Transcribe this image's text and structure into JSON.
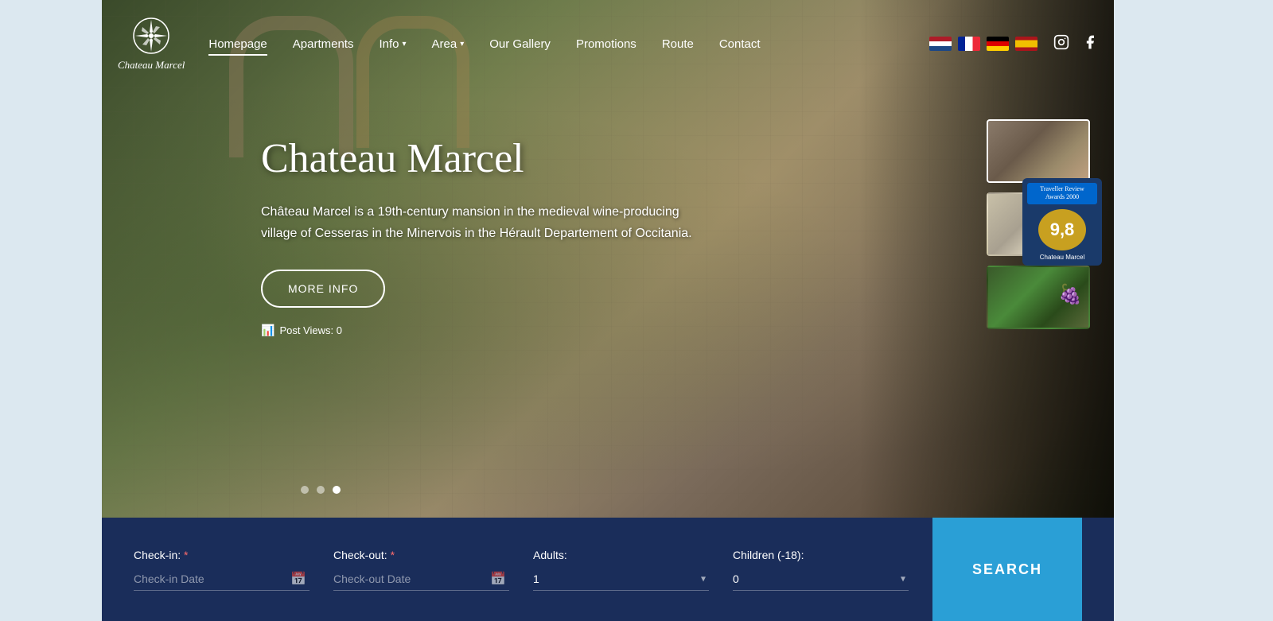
{
  "logo": {
    "line1": "Chateau Marcel"
  },
  "nav": {
    "links": [
      {
        "label": "Homepage",
        "active": true
      },
      {
        "label": "Apartments",
        "active": false
      },
      {
        "label": "Info",
        "active": false,
        "dropdown": true
      },
      {
        "label": "Area",
        "active": false,
        "dropdown": true
      },
      {
        "label": "Our Gallery",
        "active": false
      },
      {
        "label": "Promotions",
        "active": false
      },
      {
        "label": "Route",
        "active": false
      },
      {
        "label": "Contact",
        "active": false
      }
    ],
    "flags": [
      "NL",
      "FR",
      "DE",
      "ES"
    ]
  },
  "hero": {
    "title": "Chateau Marcel",
    "description": "Château Marcel is a 19th-century mansion in the medieval wine-producing village of Cesseras in the Minervois in the Hérault Departement of Occitania.",
    "more_info_label": "MORE INFO",
    "post_views_label": "Post Views: 0"
  },
  "booking": {
    "checkin_label": "Check-in:",
    "checkin_placeholder": "Check-in Date",
    "checkout_label": "Check-out:",
    "checkout_placeholder": "Check-out Date",
    "adults_label": "Adults:",
    "adults_default": "1",
    "children_label": "Children (-18):",
    "children_default": "0",
    "search_label": "SEARCH",
    "required_marker": "*"
  },
  "booking_badge": {
    "top_text": "Traveller Review Awards 2000",
    "score": "9,8",
    "hotel_name": "Chateau Marcel"
  },
  "thumbnails": [
    {
      "id": "thumb-1",
      "active": true
    },
    {
      "id": "thumb-2",
      "active": false
    },
    {
      "id": "thumb-3",
      "active": false
    }
  ]
}
